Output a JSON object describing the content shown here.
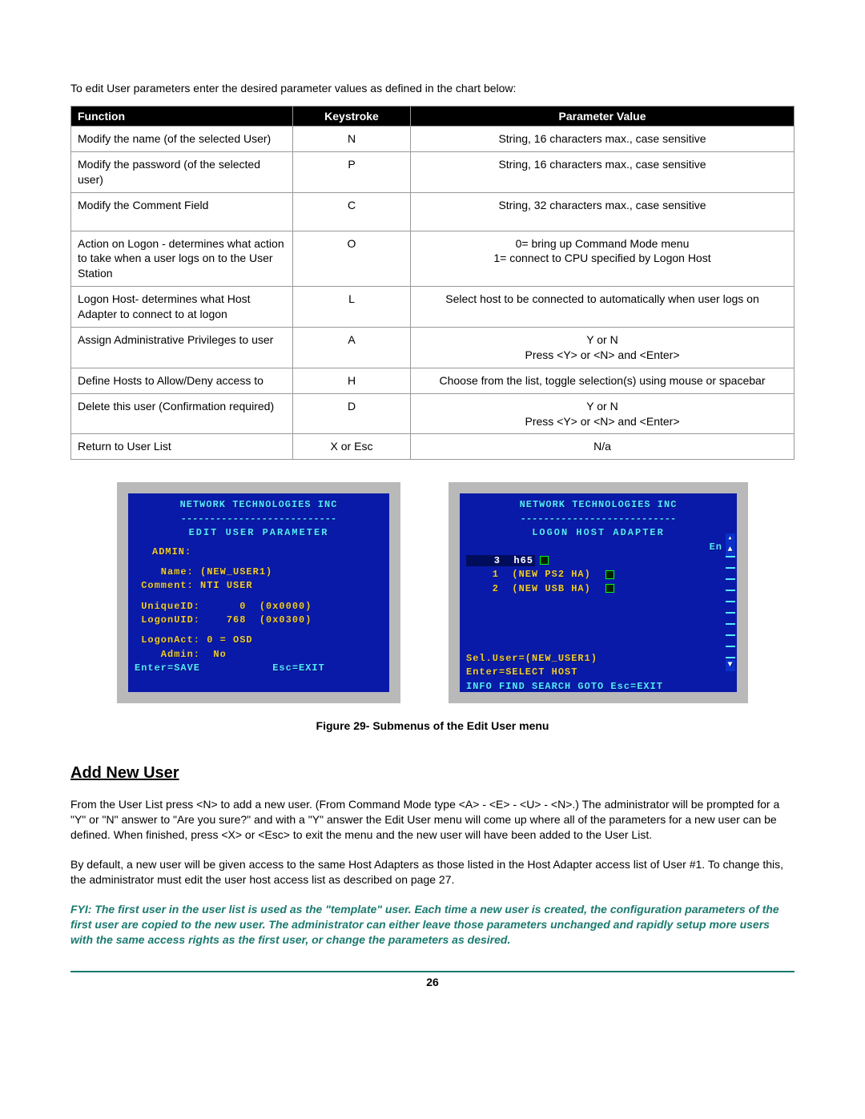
{
  "intro": "To edit User parameters enter the desired parameter values as defined in the chart below:",
  "tableHeaders": {
    "c1": "Function",
    "c2": "Keystroke",
    "c3": "Parameter Value"
  },
  "rows": [
    {
      "fn": "Modify the name (of the selected User)",
      "key": "N",
      "val": "String, 16 characters max., case sensitive"
    },
    {
      "fn": "Modify the password (of the selected user)",
      "key": "P",
      "val": "String, 16 characters max., case sensitive"
    },
    {
      "fn": "Modify the Comment Field",
      "key": "C",
      "val": "String, 32 characters max., case sensitive"
    },
    {
      "fn": "Action on Logon  - determines what action to take when a user logs on to the User Station",
      "key": "O",
      "val": "0= bring up Command Mode menu\n1= connect to CPU specified by Logon Host"
    },
    {
      "fn": "Logon Host- determines what Host Adapter to connect to at logon",
      "key": "L",
      "val": "Select host to be connected to automatically when user logs on"
    },
    {
      "fn": "Assign Administrative Privileges to user",
      "key": "A",
      "val": "Y   or  N\nPress <Y> or <N>  and <Enter>"
    },
    {
      "fn": "Define Hosts to Allow/Deny access to",
      "key": "H",
      "val": "Choose from the list, toggle selection(s) using mouse or spacebar"
    },
    {
      "fn": "Delete this user (Confirmation required)",
      "key": "D",
      "val": "Y   or  N\nPress <Y> or <N>  and <Enter>"
    },
    {
      "fn": "Return to User List",
      "key": "X or Esc",
      "val": "N/a"
    }
  ],
  "osdLeft": {
    "title": "NETWORK  TECHNOLOGIES  INC",
    "dash": "---------------------------",
    "subtitle": "EDIT USER PARAMETER",
    "admin": "ADMIN:",
    "l1": "    Name: (NEW_USER1)",
    "l2": " Comment: NTI USER",
    "l3": " UniqueID:      0  (0x0000)",
    "l4": " LogonUID:    768  (0x0300)",
    "l5": " LogonAct: 0 = OSD",
    "l6": "    Admin:  No",
    "footer": "Enter=SAVE           Esc=EXIT"
  },
  "osdRight": {
    "title": "NETWORK  TECHNOLOGIES  INC",
    "dash": "---------------------------",
    "subtitle": "LOGON HOST ADAPTER",
    "en": "En ",
    "row1": "    3  h65",
    "row2": "    1  (NEW PS2 HA)",
    "row3": "    2  (NEW USB HA)",
    "sel": "Sel.User=(NEW_USER1)",
    "enter": "Enter=SELECT HOST",
    "foot": "INFO FIND SEARCH GOTO Esc=EXIT"
  },
  "figCaption": "Figure 29- Submenus of the Edit User menu",
  "sectionHeading": "Add New User",
  "para1": "From the User List press <N> to add a new user.  (From Command Mode type <A> - <E> - <U> - <N>.)    The administrator will be prompted for a \"Y\" or \"N\" answer to \"Are you sure?\" and with a \"Y\" answer the Edit User menu will come up where all of the parameters for a new user can be defined.   When finished, press <X> or <Esc> to exit the menu and the new user will have been added to the User List.",
  "para2": "By default, a new user will be given access to the same Host Adapters as those listed in the Host Adapter access list of User #1.  To change this, the administrator must edit the user host access list as described on page 27.",
  "fyi": "FYI:   The first user in the user list is used as the \"template\" user.    Each time a new user is created,  the configuration parameters of the first user are copied to the new user.   The administrator can either leave those parameters unchanged and rapidly setup more users with the same access rights as the first user, or change the parameters as desired.",
  "pageNumber": "26"
}
